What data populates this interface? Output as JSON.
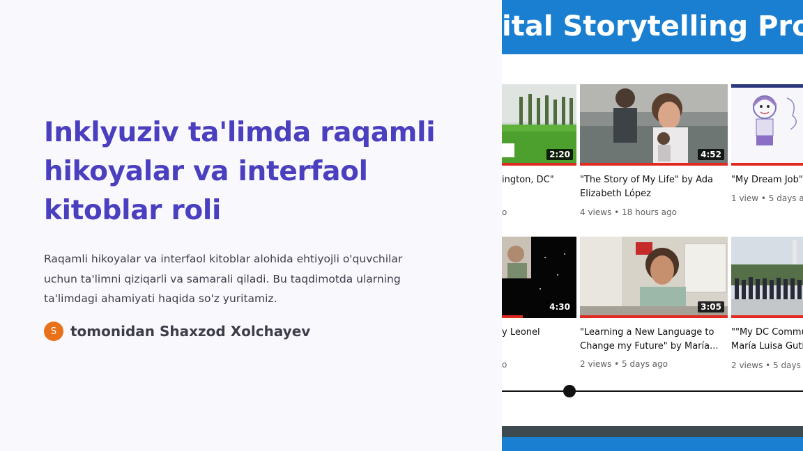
{
  "slide": {
    "title": "Inklyuziv ta'limda raqamli hikoyalar va interfaol kitoblar roli",
    "description": "Raqamli hikoyalar va interfaol kitoblar alohida ehtiyojli o'quvchilar uchun ta'limni qiziqarli va samarali qiladi. Bu taqdimotda ularning ta'limdagi ahamiyati haqida so'z yuritamiz.",
    "author_initial": "S",
    "author": "tomonidan Shaxzod Xolchayev",
    "accent_color": "#4a3fbf",
    "avatar_color": "#e8711a"
  },
  "screenshot": {
    "banner_text": "ital Storytelling Proj",
    "banner_color": "#1a7fd1",
    "videos": [
      {
        "title_line1": "ington, DC\"",
        "title_line2": "",
        "meta": "o",
        "duration": "2:20"
      },
      {
        "title_line1": "\"The Story of My Life\" by Ada",
        "title_line2": "Elizabeth López",
        "meta": "4 views • 18 hours ago",
        "duration": "4:52"
      },
      {
        "title_line1": "\"My Dream Job\"",
        "title_line2": "",
        "meta": "1 view • 5 days ago",
        "duration": ""
      },
      {
        "title_line1": "y Leonel",
        "title_line2": "",
        "meta": "o",
        "duration": "4:30"
      },
      {
        "title_line1": "\"Learning a New Language to",
        "title_line2": "Change my Future\" by María...",
        "meta": "2 views • 5 days ago",
        "duration": "3:05"
      },
      {
        "title_line1": "\"\"My DC Commu",
        "title_line2": "María Luisa Guti",
        "meta": "2 views • 5 days ag",
        "duration": ""
      }
    ]
  }
}
